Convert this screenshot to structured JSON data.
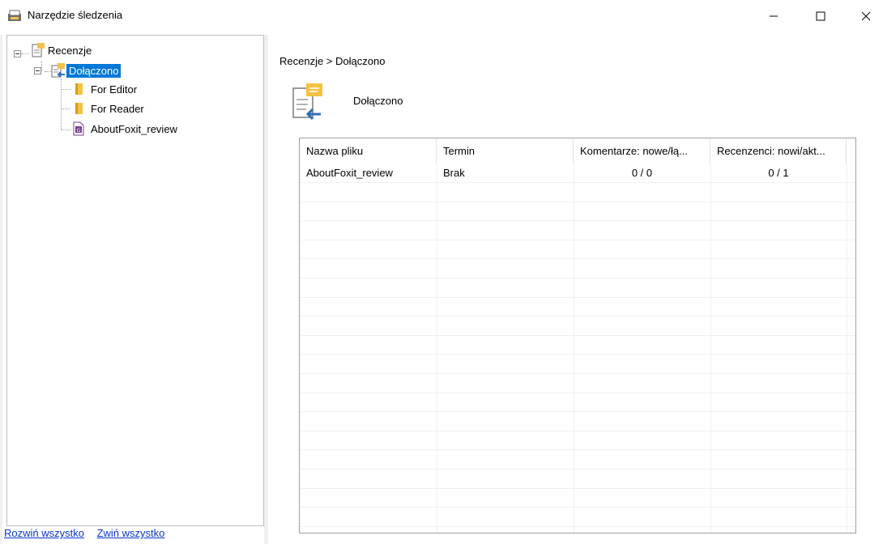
{
  "window": {
    "title": "Narzędzie śledzenia",
    "buttons": {
      "minimize": "—",
      "maximize": "☐",
      "close": "✕"
    }
  },
  "tree": {
    "root": {
      "label": "Recenzje",
      "icon": "reviews-icon"
    },
    "selected": {
      "label": "Dołączono",
      "icon": "joined-review-icon"
    },
    "children": [
      {
        "label": "For Editor",
        "icon": "folder-icon"
      },
      {
        "label": "For Reader",
        "icon": "folder-icon"
      },
      {
        "label": "AboutFoxit_review",
        "icon": "pdf-file-icon"
      }
    ]
  },
  "footer": {
    "expand_all": "Rozwiń wszystko",
    "collapse_all": "Zwiń wszystko"
  },
  "main": {
    "breadcrumb": "Recenzje > Dołączono",
    "header_label": "Dołączono",
    "table": {
      "columns": [
        "Nazwa pliku",
        "Termin",
        "Komentarze: nowe/łą...",
        "Recenzenci: nowi/akt..."
      ],
      "rows": [
        [
          "AboutFoxit_review",
          "Brak",
          "0 / 0",
          "0 / 1"
        ]
      ]
    }
  },
  "colors": {
    "selection": "#0078d7",
    "link": "#0b36cf",
    "folder": "#f5c242"
  }
}
